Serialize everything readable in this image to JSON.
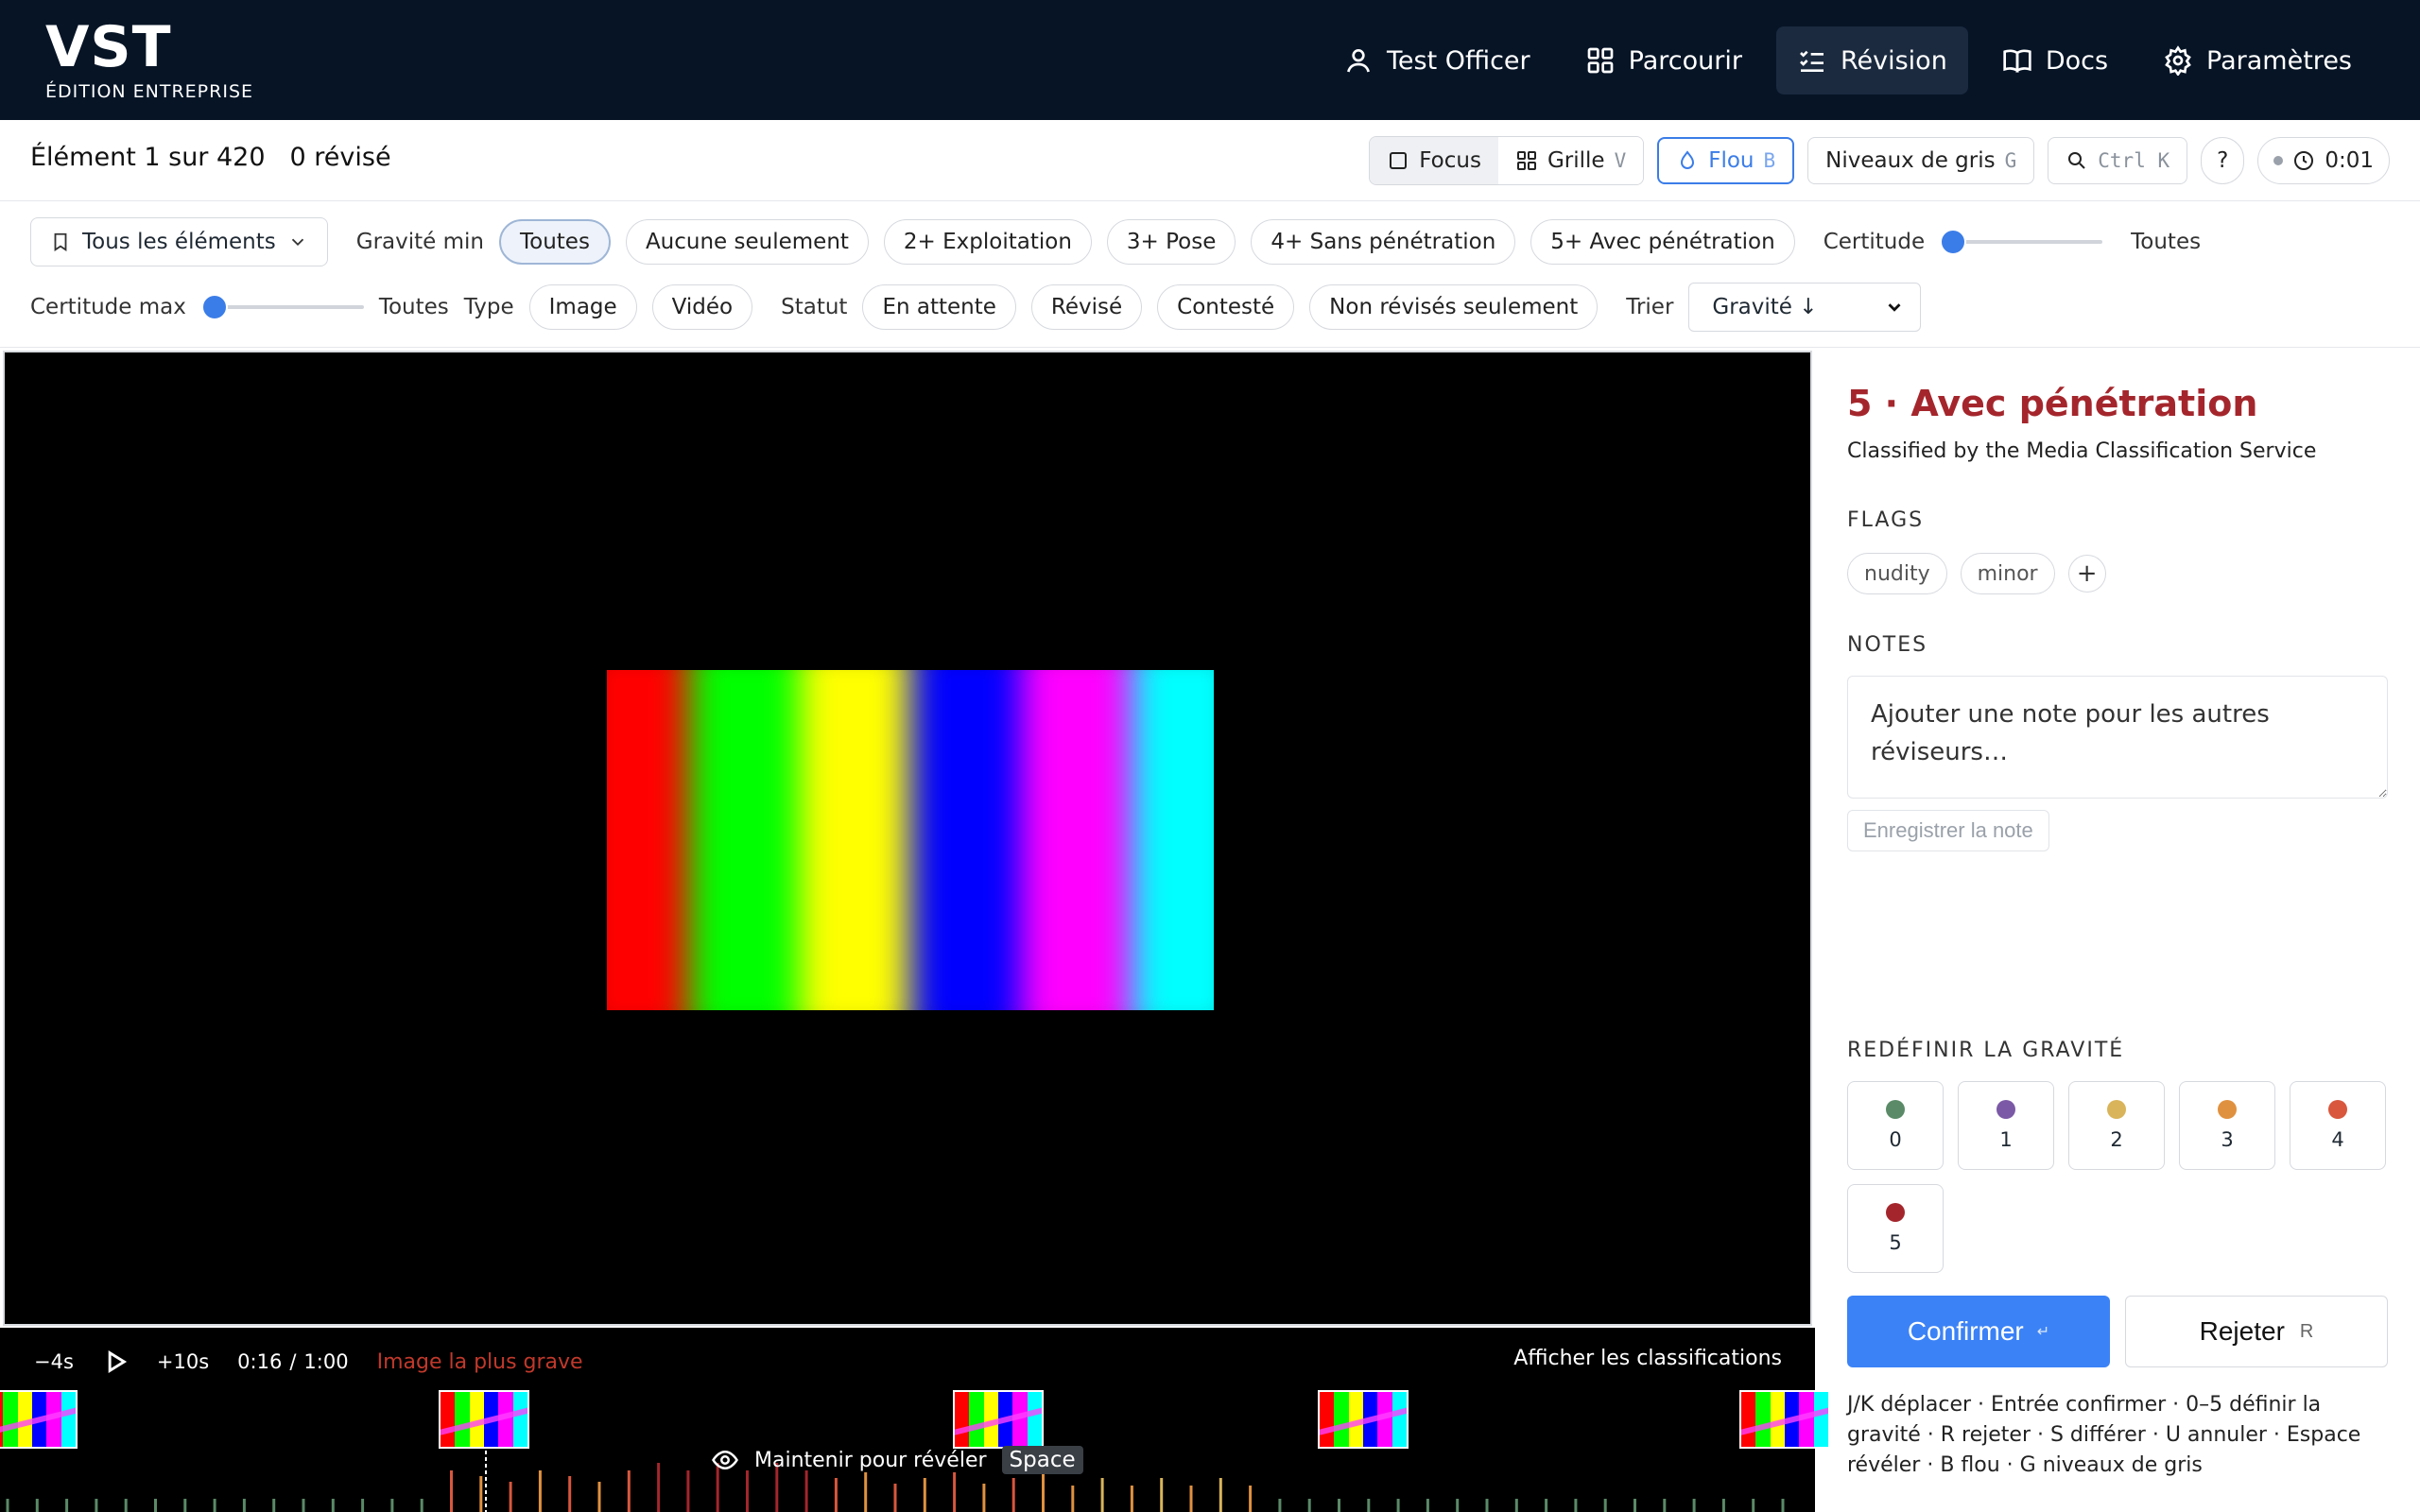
{
  "logo": {
    "main": "VST",
    "sub": "ÉDITION ENTREPRISE"
  },
  "nav": [
    {
      "label": "Test Officer",
      "icon": "user-icon"
    },
    {
      "label": "Parcourir",
      "icon": "grid-icon"
    },
    {
      "label": "Révision",
      "icon": "checklist-icon",
      "active": true
    },
    {
      "label": "Docs",
      "icon": "book-icon"
    },
    {
      "label": "Paramètres",
      "icon": "gear-icon"
    }
  ],
  "status": {
    "position": "Élément 1 sur 420",
    "reviewed": "0 révisé"
  },
  "tools": {
    "focus": "Focus",
    "grid": "Grille",
    "grid_key": "V",
    "blur": "Flou",
    "blur_key": "B",
    "grayscale": "Niveaux de gris",
    "grayscale_key": "G",
    "search_key": "Ctrl K",
    "help": "?",
    "timer": "0:01"
  },
  "filters": {
    "all_items": "Tous les éléments",
    "severity_label": "Gravité min",
    "severity_options": [
      "Toutes",
      "Aucune seulement",
      "2+ Exploitation",
      "3+ Pose",
      "4+ Sans pénétration",
      "5+ Avec pénétration"
    ],
    "severity_selected": "Toutes",
    "certainty_label": "Certitude",
    "certainty_value": "Toutes",
    "certainty_max_label": "Certitude max",
    "certainty_max_value": "Toutes",
    "type_label": "Type",
    "type_options": [
      "Image",
      "Vidéo"
    ],
    "status_label": "Statut",
    "status_options": [
      "En attente",
      "Révisé",
      "Contesté",
      "Non révisés seulement"
    ],
    "sort_label": "Trier",
    "sort_value": "Gravité ↓"
  },
  "media_colors": [
    "#ff0000",
    "#00ff00",
    "#ffff00",
    "#0000ff",
    "#ff00ff",
    "#00ffff"
  ],
  "timeline": {
    "back": "−4s",
    "forward": "+10s",
    "current": "0:16",
    "separator": "/",
    "duration": "1:00",
    "worst_frame": "Image la plus grave",
    "show_classifications": "Afficher les classifications",
    "reveal": "Maintenir pour révéler",
    "reveal_key": "Space"
  },
  "panel": {
    "title": "5 · Avec pénétration",
    "subtitle": "Classified by the Media Classification Service",
    "flags_title": "FLAGS",
    "flags": [
      "nudity",
      "minor"
    ],
    "notes_title": "NOTES",
    "notes_placeholder": "Ajouter une note pour les autres réviseurs…",
    "save_note": "Enregistrer la note",
    "override_title": "REDÉFINIR LA GRAVITÉ",
    "severity_levels": [
      {
        "label": "0",
        "color": "#5a8a67"
      },
      {
        "label": "1",
        "color": "#7b59a6"
      },
      {
        "label": "2",
        "color": "#d9b45a"
      },
      {
        "label": "3",
        "color": "#e0913f"
      },
      {
        "label": "4",
        "color": "#d8573d"
      },
      {
        "label": "5",
        "color": "#a4262c"
      }
    ],
    "confirm": "Confirmer",
    "confirm_key": "↵",
    "reject": "Rejeter",
    "reject_key": "R",
    "shortcuts": "J/K déplacer · Entrée confirmer · 0–5 définir la gravité · R rejeter · S différer · U annuler · Espace révéler · B flou · G niveaux de gris"
  }
}
